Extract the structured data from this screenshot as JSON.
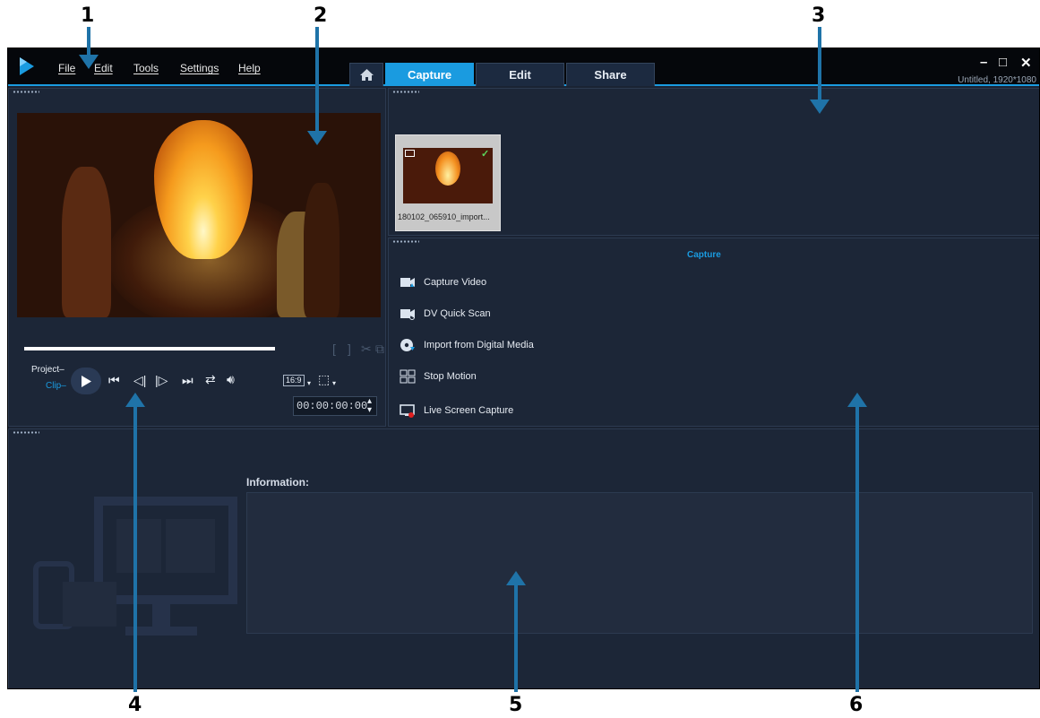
{
  "callouts": [
    "1",
    "2",
    "3",
    "4",
    "5",
    "6"
  ],
  "menu": {
    "file": "File",
    "edit": "Edit",
    "tools": "Tools",
    "settings": "Settings",
    "help": "Help"
  },
  "tabs": {
    "home_icon": "home-icon",
    "capture": "Capture",
    "edit": "Edit",
    "share": "Share"
  },
  "window": {
    "minimize": "–",
    "maximize": "□",
    "close": "✕",
    "project_title": "Untitled, 1920*1080"
  },
  "player": {
    "project_label": "Project–",
    "clip_label": "Clip–",
    "aspect": "16:9",
    "timecode": "00:00:00:00"
  },
  "library": {
    "thumbnail_caption": "180102_065910_import..."
  },
  "capture_panel": {
    "heading": "Capture",
    "options": [
      {
        "label": "Capture Video",
        "icon": "capture-video-icon"
      },
      {
        "label": "DV Quick Scan",
        "icon": "dv-quick-scan-icon"
      },
      {
        "label": "Import from Digital Media",
        "icon": "import-digital-media-icon"
      },
      {
        "label": "Stop Motion",
        "icon": "stop-motion-icon"
      },
      {
        "label": "Live Screen Capture",
        "icon": "live-screen-capture-icon"
      }
    ]
  },
  "info": {
    "label": "Information:"
  },
  "colors": {
    "accent": "#1a9be0",
    "background": "#1a2333",
    "callout_arrow": "#1f73a8"
  }
}
